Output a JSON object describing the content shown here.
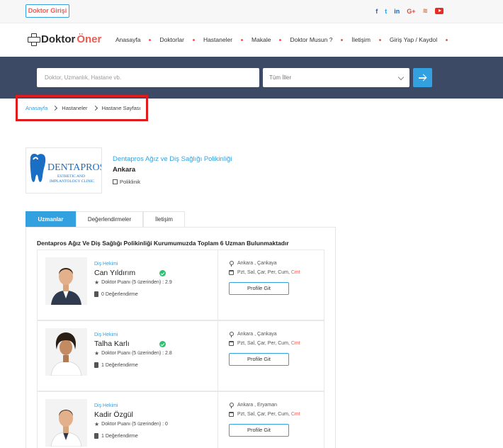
{
  "topbar": {
    "login_label": "Doktor Girişi",
    "social": [
      {
        "name": "facebook-icon",
        "glyph": "f"
      },
      {
        "name": "twitter-icon",
        "glyph": "t"
      },
      {
        "name": "linkedin-icon",
        "glyph": "in"
      },
      {
        "name": "googleplus-icon",
        "glyph": "G+"
      },
      {
        "name": "rss-icon",
        "glyph": "≋"
      },
      {
        "name": "youtube-icon",
        "glyph": ""
      }
    ]
  },
  "brand": {
    "name_part1": "Doktor",
    "name_part2": "Öner",
    "accent_color": "#f05a4f",
    "primary_color": "#33a1e0"
  },
  "nav": {
    "items": [
      "Anasayfa",
      "Doktorlar",
      "Hastaneler",
      "Makale",
      "Doktor Musun ?",
      "İletişim",
      "Giriş Yap / Kaydol"
    ]
  },
  "search": {
    "placeholder": "Doktor, Uzmanlık, Hastane vb.",
    "city_selected": "Tüm İller"
  },
  "breadcrumb": {
    "items": [
      "Anasayfa",
      "Hastaneler",
      "Hastane Sayfası"
    ]
  },
  "hospital": {
    "logo_text_main": "DENTAPROS",
    "logo_text_sub1": "ESTHETIC AND",
    "logo_text_sub2": "IMPLANTOLOGY CLINIC",
    "name": "Dentapros Ağız ve Diş Sağlığı Polikinliği",
    "city": "Ankara",
    "type": "Poliklinik"
  },
  "tabs": [
    {
      "label": "Uzmanlar",
      "active": true
    },
    {
      "label": "Değerlendirmeler",
      "active": false
    },
    {
      "label": "İletişim",
      "active": false
    }
  ],
  "panel": {
    "title": "Dentapros Ağız Ve Diş Sağlığı Polikinliği Kurumumuzda Toplam 6 Uzman Bulunmaktadır"
  },
  "doctors": [
    {
      "specialty": "Diş Hekimi",
      "name": "Can Yıldırım",
      "verified": true,
      "score": "Doktor Puanı (5 üzerinden) : 2.9",
      "reviews": "0 Değerlendirme",
      "location": "Ankara , Çankaya",
      "days": "Pzt, Sal, Çar, Per, Cum,",
      "weekend": "Cmt",
      "button": "Profile Git"
    },
    {
      "specialty": "Diş Hekimi",
      "name": "Talha Karlı",
      "verified": true,
      "score": "Doktor Puanı (5 üzerinden) : 2.8",
      "reviews": "1 Değerlendirme",
      "location": "Ankara , Çankaya",
      "days": "Pzt, Sal, Çar, Per, Cum,",
      "weekend": "Cmt",
      "button": "Profile Git"
    },
    {
      "specialty": "Diş Hekimi",
      "name": "Kadir Özgül",
      "verified": false,
      "score": "Doktor Puanı (5 üzerinden) : 0",
      "reviews": "1 Değerlendirme",
      "location": "Ankara , Eryaman",
      "days": "Pzt, Sal, Çar, Per, Cum,",
      "weekend": "Cmt",
      "button": "Profile Git"
    }
  ]
}
